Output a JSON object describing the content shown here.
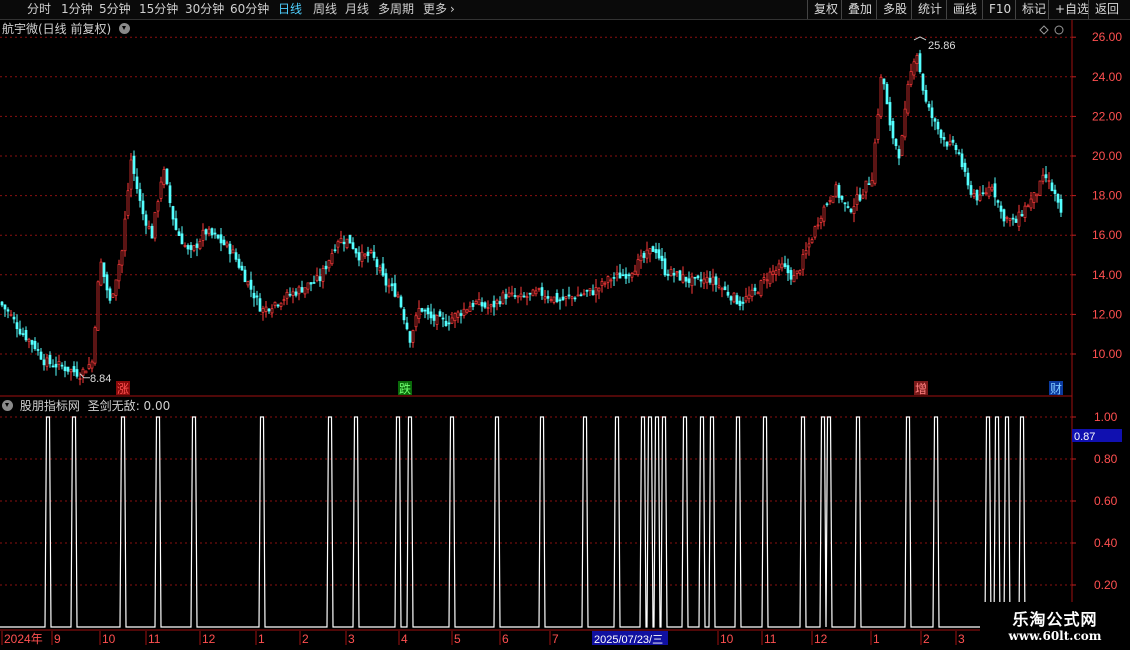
{
  "toolbar": {
    "periods": [
      "分时",
      "1分钟",
      "5分钟",
      "15分钟",
      "30分钟",
      "60分钟",
      "日线",
      "周线",
      "月线",
      "多周期",
      "更多"
    ],
    "active_period": "日线",
    "right_buttons": [
      "复权",
      "叠加",
      "多股",
      "统计",
      "画线",
      "F10",
      "标记",
      "+自选",
      "返回"
    ]
  },
  "main_panel": {
    "title": "航宇微(日线 前复权)"
  },
  "indicator_panel": {
    "title": "股朋指标网",
    "indicator_name": "圣剑无敌",
    "indicator_value": "0.00",
    "current_value_badge": "0.87"
  },
  "chart_data": {
    "type": "candlestick",
    "price_axis": {
      "ticks": [
        10.0,
        12.0,
        14.0,
        16.0,
        18.0,
        20.0,
        22.0,
        24.0,
        26.0
      ],
      "range": [
        9.0,
        26.5
      ]
    },
    "high_marker": "25.86",
    "low_marker": "8.84",
    "event_markers": [
      "涨",
      "跌",
      "增",
      "财"
    ],
    "price_path": [
      [
        0,
        12.6
      ],
      [
        10,
        12.0
      ],
      [
        20,
        11.2
      ],
      [
        35,
        10.4
      ],
      [
        45,
        9.6
      ],
      [
        60,
        9.4
      ],
      [
        80,
        9.0
      ],
      [
        92,
        9.6
      ],
      [
        100,
        14.8
      ],
      [
        110,
        12.6
      ],
      [
        122,
        15.2
      ],
      [
        131,
        19.8
      ],
      [
        142,
        17.2
      ],
      [
        152,
        16.0
      ],
      [
        163,
        19.4
      ],
      [
        175,
        16.4
      ],
      [
        190,
        15.0
      ],
      [
        205,
        16.2
      ],
      [
        218,
        15.8
      ],
      [
        232,
        15.2
      ],
      [
        248,
        13.6
      ],
      [
        262,
        12.2
      ],
      [
        275,
        12.6
      ],
      [
        290,
        13.0
      ],
      [
        305,
        13.4
      ],
      [
        320,
        13.8
      ],
      [
        338,
        15.8
      ],
      [
        350,
        15.7
      ],
      [
        360,
        14.9
      ],
      [
        372,
        15.0
      ],
      [
        385,
        13.6
      ],
      [
        398,
        13.0
      ],
      [
        410,
        10.8
      ],
      [
        420,
        12.4
      ],
      [
        430,
        11.8
      ],
      [
        445,
        11.6
      ],
      [
        460,
        12.1
      ],
      [
        475,
        12.6
      ],
      [
        490,
        12.3
      ],
      [
        505,
        13.0
      ],
      [
        520,
        12.8
      ],
      [
        540,
        13.1
      ],
      [
        560,
        12.7
      ],
      [
        580,
        13.0
      ],
      [
        595,
        13.2
      ],
      [
        610,
        13.8
      ],
      [
        628,
        14.1
      ],
      [
        645,
        14.9
      ],
      [
        655,
        15.4
      ],
      [
        665,
        14.2
      ],
      [
        680,
        13.9
      ],
      [
        695,
        13.6
      ],
      [
        710,
        13.8
      ],
      [
        725,
        13.2
      ],
      [
        740,
        12.6
      ],
      [
        755,
        13.1
      ],
      [
        768,
        14.0
      ],
      [
        782,
        14.4
      ],
      [
        795,
        13.8
      ],
      [
        808,
        15.4
      ],
      [
        820,
        17.0
      ],
      [
        835,
        18.4
      ],
      [
        848,
        17.2
      ],
      [
        860,
        18.0
      ],
      [
        872,
        19.0
      ],
      [
        882,
        24.4
      ],
      [
        890,
        21.4
      ],
      [
        900,
        20.0
      ],
      [
        908,
        23.4
      ],
      [
        916,
        25.5
      ],
      [
        925,
        22.8
      ],
      [
        935,
        21.6
      ],
      [
        948,
        20.6
      ],
      [
        958,
        20.3
      ],
      [
        968,
        18.4
      ],
      [
        980,
        17.8
      ],
      [
        992,
        18.6
      ],
      [
        1002,
        17.0
      ],
      [
        1015,
        16.6
      ],
      [
        1025,
        17.4
      ],
      [
        1035,
        18.0
      ],
      [
        1045,
        19.0
      ],
      [
        1055,
        18.0
      ],
      [
        1063,
        16.6
      ]
    ],
    "indicator_axis": {
      "ticks": [
        0.2,
        0.4,
        0.6,
        0.8,
        1.0
      ],
      "range": [
        0.0,
        1.0
      ]
    },
    "indicator_signals": [
      48,
      74,
      123,
      158,
      194,
      262,
      330,
      356,
      398,
      410,
      452,
      497,
      542,
      585,
      617,
      643,
      650,
      657,
      664,
      685,
      702,
      712,
      738,
      765,
      803,
      823,
      829,
      858,
      908,
      936,
      988,
      997,
      1007,
      1022
    ],
    "x_axis": {
      "labels": [
        {
          "text": "2024年",
          "pos": 2
        },
        {
          "text": "9",
          "pos": 52
        },
        {
          "text": "10",
          "pos": 100
        },
        {
          "text": "11",
          "pos": 146
        },
        {
          "text": "12",
          "pos": 200
        },
        {
          "text": "1",
          "pos": 256
        },
        {
          "text": "2",
          "pos": 300
        },
        {
          "text": "3",
          "pos": 346
        },
        {
          "text": "4",
          "pos": 399
        },
        {
          "text": "5",
          "pos": 452
        },
        {
          "text": "6",
          "pos": 500
        },
        {
          "text": "7",
          "pos": 550
        },
        {
          "text": "10",
          "pos": 718
        },
        {
          "text": "11",
          "pos": 762
        },
        {
          "text": "12",
          "pos": 812
        },
        {
          "text": "1",
          "pos": 871
        },
        {
          "text": "2",
          "pos": 921
        },
        {
          "text": "3",
          "pos": 956
        }
      ],
      "highlight_date": "2025/07/23/三"
    },
    "colors": {
      "up": "#ff3a3a",
      "down": "#54ffff",
      "grid": "#8a1010",
      "indicator": "#ffffff",
      "badge": "#1010b0"
    }
  },
  "watermark": {
    "line1": "乐淘公式网",
    "line2": "www.60lt.com"
  }
}
